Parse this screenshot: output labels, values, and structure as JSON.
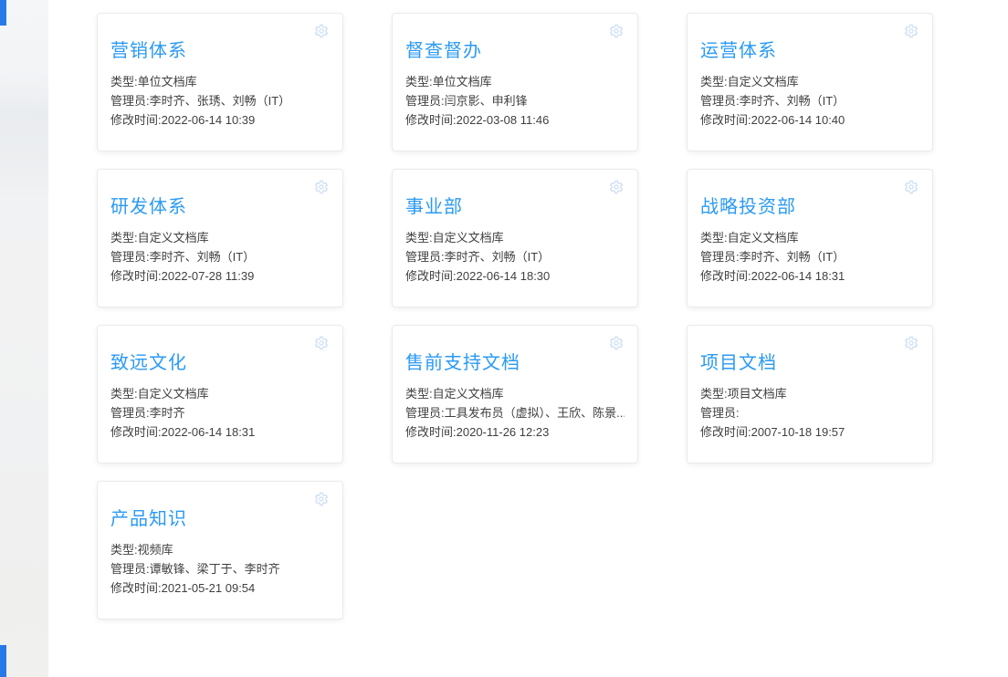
{
  "page": {
    "background_color": "#ffffff",
    "left_band_base_color": "#eff1f3",
    "edge_strip_color": "#2879e8",
    "accent_blue": "#2b9af3",
    "body_text_color": "#3f3f3f",
    "gear_icon_color": "#cfe0f4"
  },
  "labels": {
    "type_prefix": "类型:",
    "admin_prefix": "管理员:",
    "modified_prefix": "修改时间:"
  },
  "cards": [
    {
      "title": "营销体系",
      "type": "单位文档库",
      "admins": "李时齐、张琇、刘畅（IT）",
      "modified": "2022-06-14 10:39"
    },
    {
      "title": "督查督办",
      "type": "单位文档库",
      "admins": "闫京影、申利锋",
      "modified": "2022-03-08 11:46"
    },
    {
      "title": "运营体系",
      "type": "自定义文档库",
      "admins": "李时齐、刘畅（IT）",
      "modified": "2022-06-14 10:40"
    },
    {
      "title": "研发体系",
      "type": "自定义文档库",
      "admins": "李时齐、刘畅（IT）",
      "modified": "2022-07-28 11:39"
    },
    {
      "title": "事业部",
      "type": "自定义文档库",
      "admins": "李时齐、刘畅（IT）",
      "modified": "2022-06-14 18:30"
    },
    {
      "title": "战略投资部",
      "type": "自定义文档库",
      "admins": "李时齐、刘畅（IT）",
      "modified": "2022-06-14 18:31"
    },
    {
      "title": "致远文化",
      "type": "自定义文档库",
      "admins": "李时齐",
      "modified": "2022-06-14 18:31"
    },
    {
      "title": "售前支持文档",
      "type": "自定义文档库",
      "admins": "工具发布员（虚拟）、王欣、陈景...",
      "modified": "2020-11-26 12:23"
    },
    {
      "title": "项目文档",
      "type": "项目文档库",
      "admins": "",
      "modified": "2007-10-18 19:57"
    },
    {
      "title": "产品知识",
      "type": "视频库",
      "admins": "谭敏锋、梁丁于、李时齐",
      "modified": "2021-05-21 09:54"
    }
  ]
}
